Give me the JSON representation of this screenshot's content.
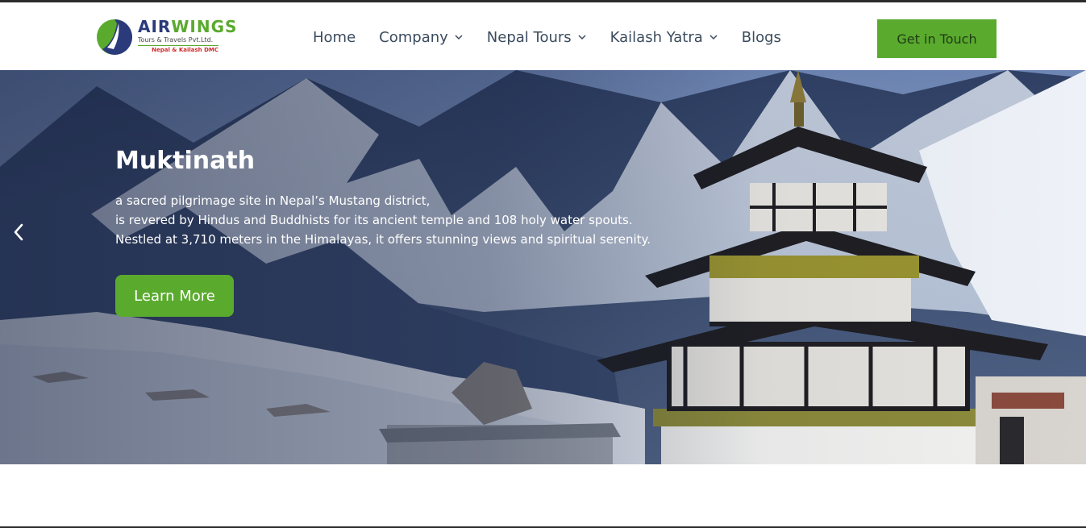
{
  "brand": {
    "name_part1": "AIR",
    "name_part2": "WINGS",
    "subtitle": "Tours & Travels Pvt.Ltd.",
    "tagline": "Nepal & Kailash DMC"
  },
  "nav": {
    "items": [
      {
        "label": "Home",
        "dropdown": false
      },
      {
        "label": "Company",
        "dropdown": true
      },
      {
        "label": "Nepal Tours",
        "dropdown": true
      },
      {
        "label": "Kailash Yatra",
        "dropdown": true
      },
      {
        "label": "Blogs",
        "dropdown": false
      }
    ],
    "cta_label": "Get in Touch"
  },
  "hero": {
    "title": "Muktinath",
    "lines": [
      "a sacred pilgrimage site in Nepal’s Mustang district,",
      " is revered by Hindus and Buddhists for its ancient temple and 108 holy water spouts.",
      " Nestled at 3,710 meters in the Himalayas, it offers stunning views and spiritual serenity."
    ],
    "button_label": "Learn More"
  },
  "colors": {
    "accent": "#5aaa2e",
    "nav_text": "#3b4b5e",
    "brand_blue": "#2b3a7a"
  }
}
